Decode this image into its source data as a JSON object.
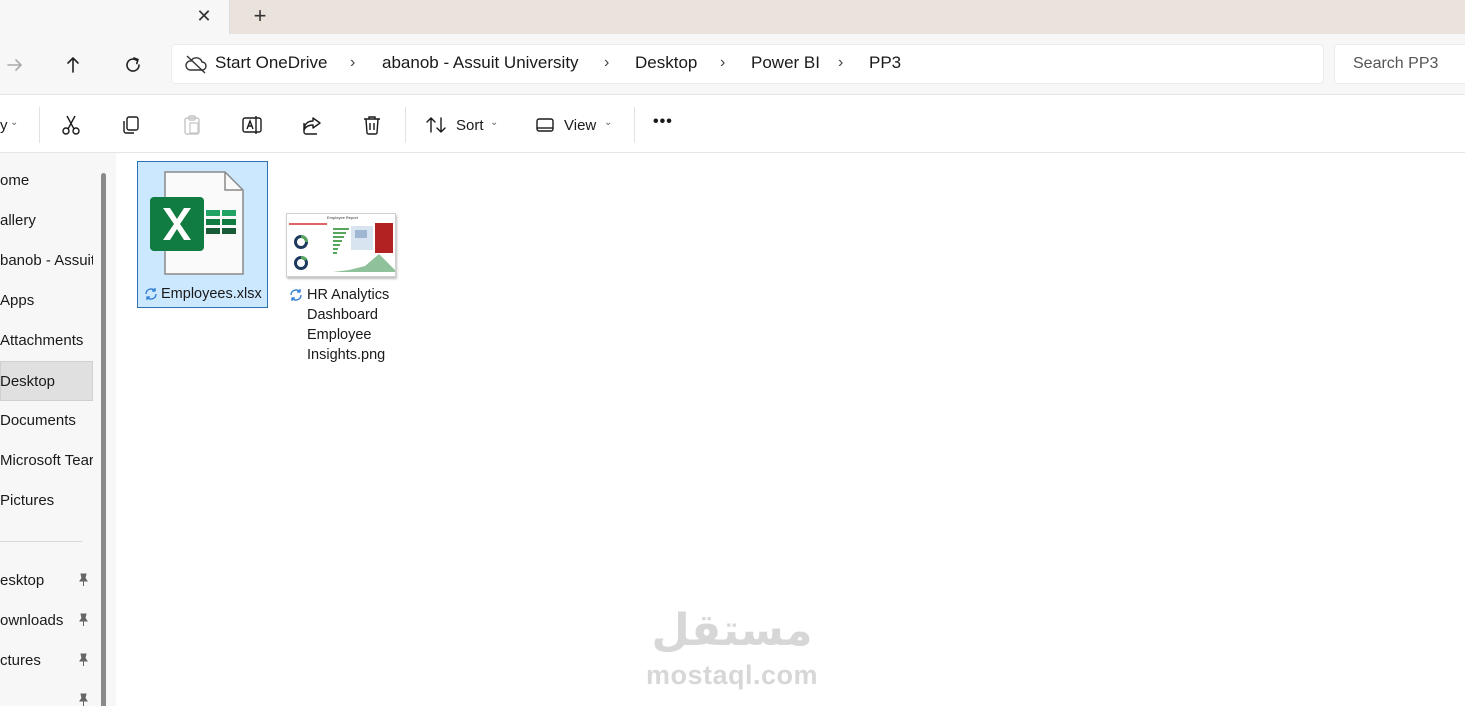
{
  "tabbar": {
    "close_glyph": "✕",
    "new_tab_glyph": "+"
  },
  "nav": {
    "breadcrumbs": [
      {
        "label": "Start OneDrive"
      },
      {
        "label": "abanob - Assuit University"
      },
      {
        "label": "Desktop"
      },
      {
        "label": "Power BI"
      },
      {
        "label": "PP3"
      }
    ],
    "separator": "›",
    "search_placeholder": "Search PP3"
  },
  "toolbar": {
    "new_partial": "y",
    "sort_label": "Sort",
    "view_label": "View",
    "more_glyph": "•••"
  },
  "sidebar": {
    "items": [
      {
        "label": "ome"
      },
      {
        "label": "allery"
      },
      {
        "label": "banob - Assuit"
      },
      {
        "label": "Apps"
      },
      {
        "label": "Attachments"
      },
      {
        "label": "Desktop"
      },
      {
        "label": "Documents"
      },
      {
        "label": "Microsoft Tear"
      },
      {
        "label": "Pictures"
      }
    ],
    "selected_index": 5,
    "quick_access": [
      {
        "label": "esktop"
      },
      {
        "label": "ownloads"
      },
      {
        "label": "ctures"
      },
      {
        "label": ""
      }
    ]
  },
  "files": [
    {
      "name": "Employees.xlsx",
      "type": "excel",
      "selected": true
    },
    {
      "name_lines": [
        "HR Analytics",
        "Dashboard",
        "Employee",
        "Insights.png"
      ],
      "type": "image",
      "selected": false,
      "thumb_title": "Employee Report"
    }
  ],
  "colors": {
    "excel_green": "#107c41",
    "selection_bg": "#cce8ff",
    "selection_border": "#2f6fb3",
    "sync_blue": "#2b7cd3"
  },
  "watermark": {
    "arabic": "مستقل",
    "latin": "mostaql.com"
  }
}
